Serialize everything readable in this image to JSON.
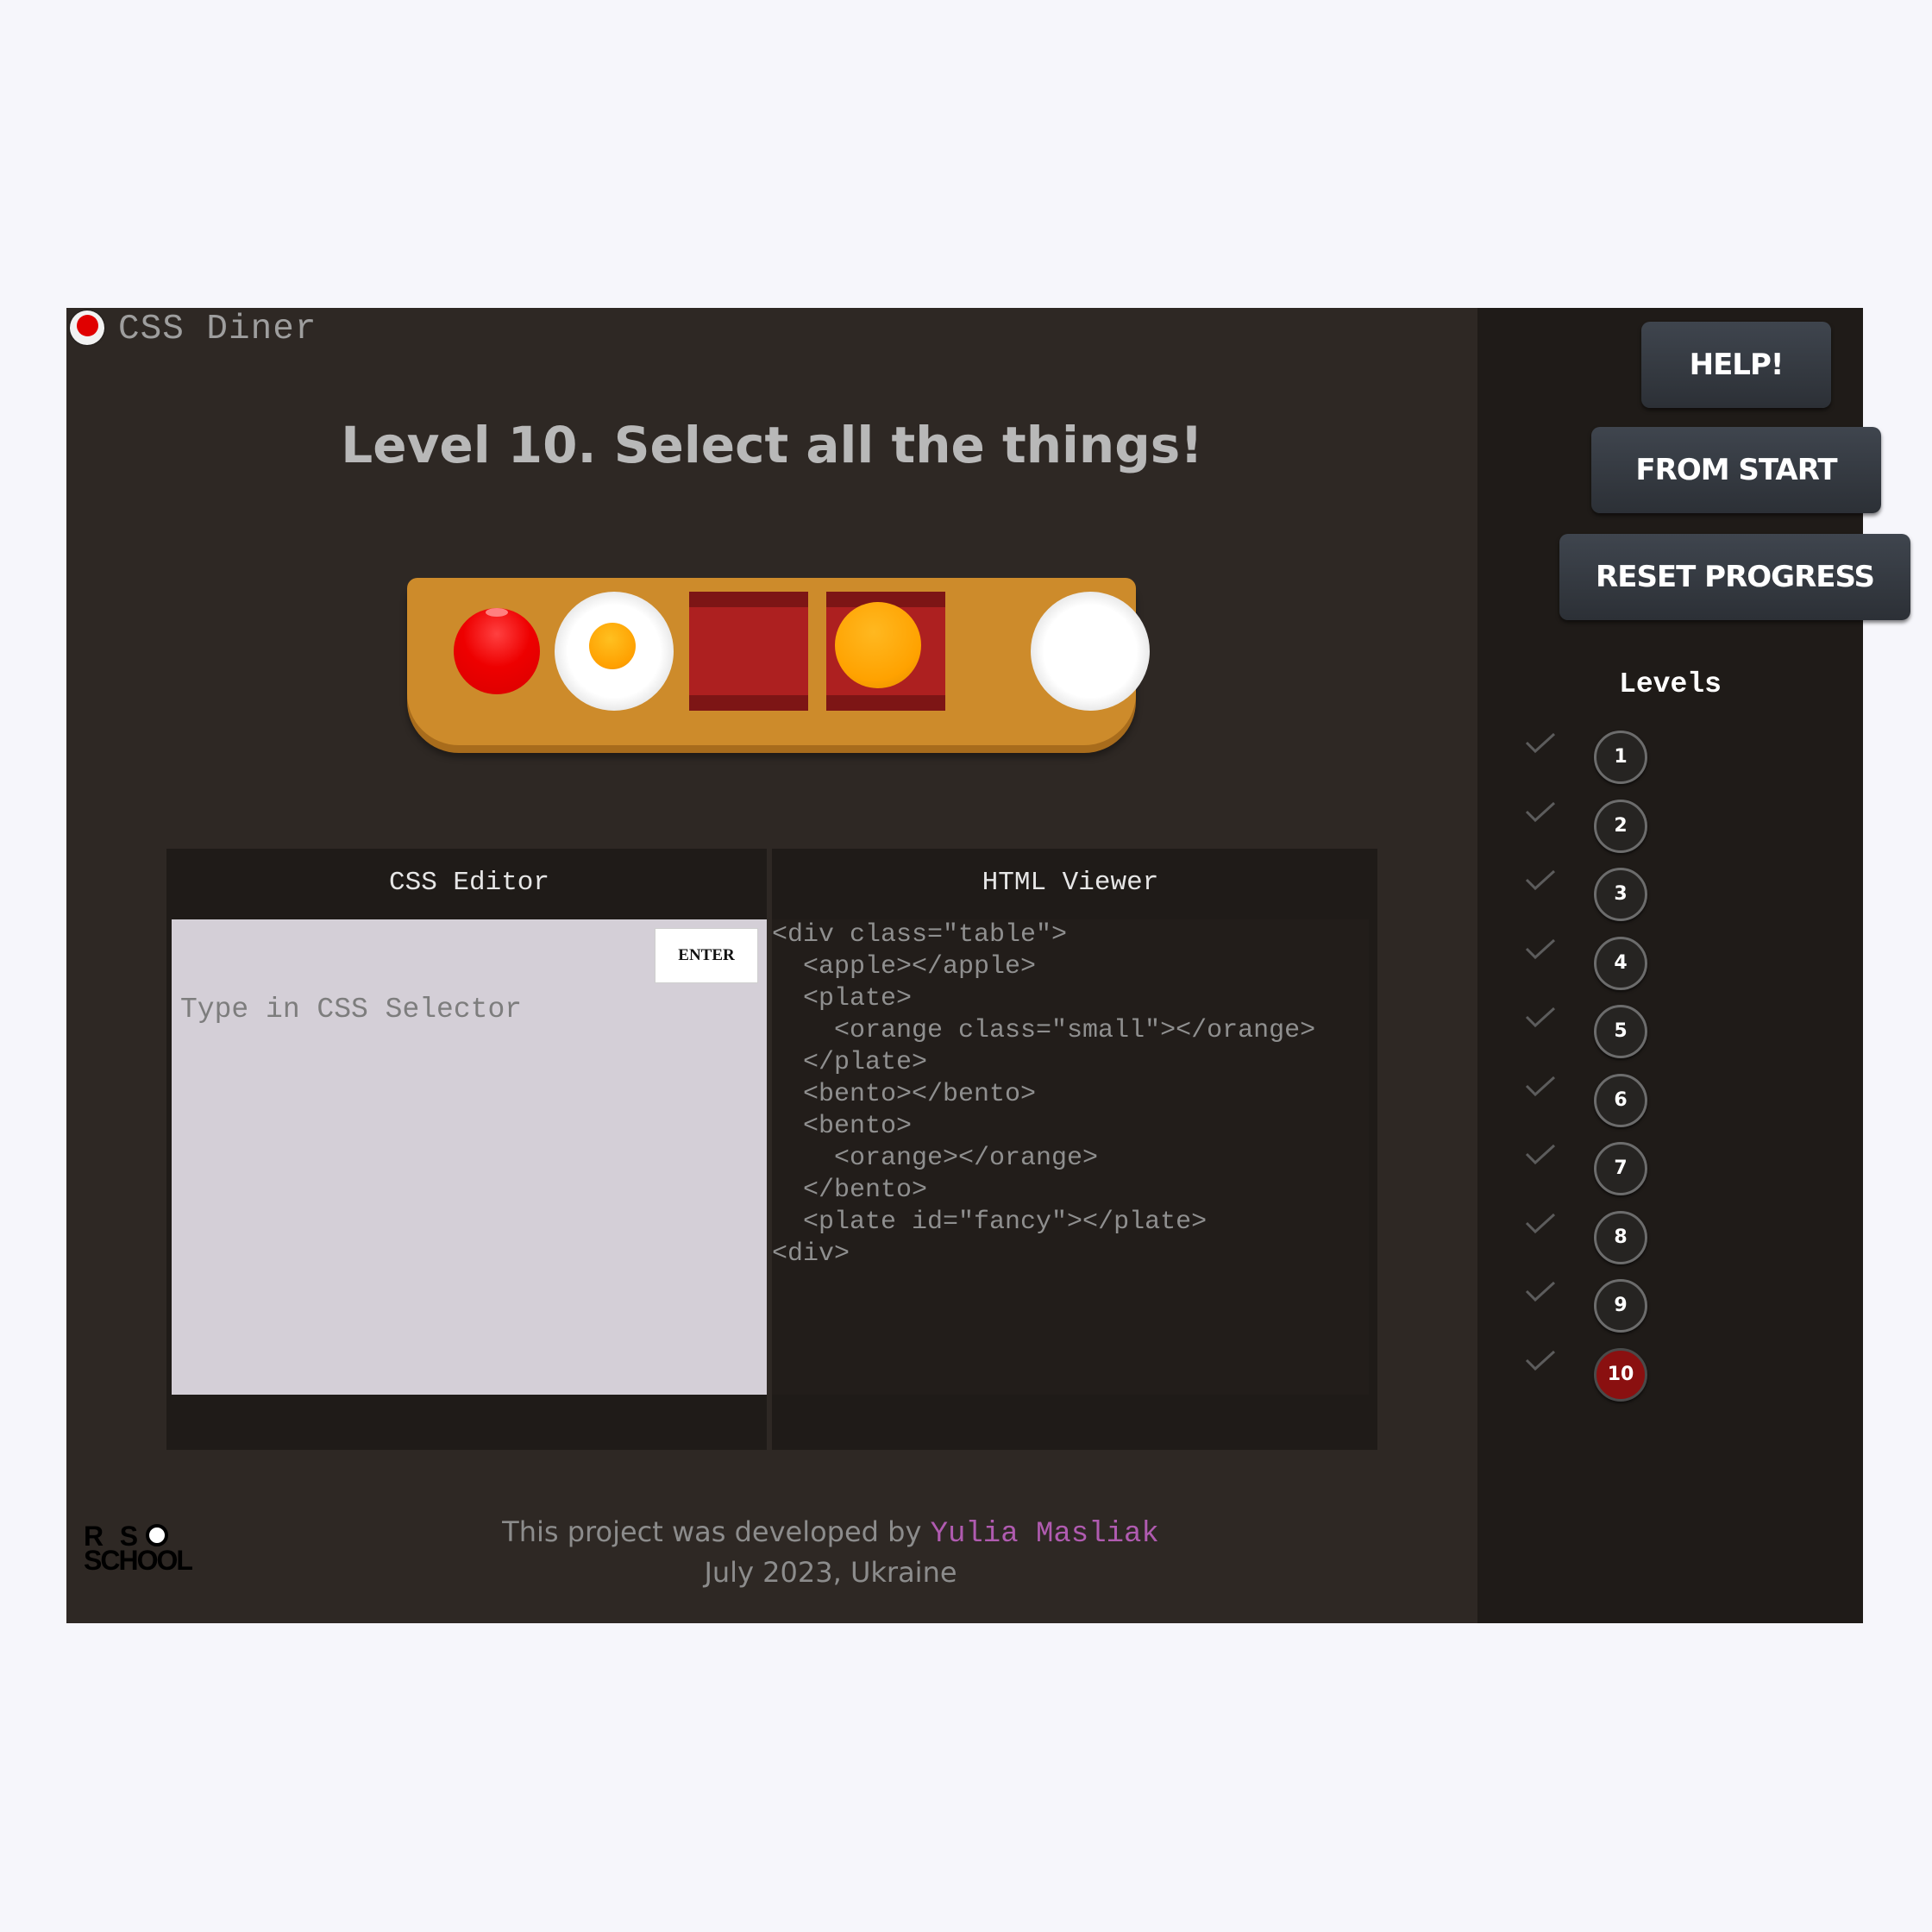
{
  "app": {
    "brand": "CSS Diner"
  },
  "level": {
    "title": "Level 10. Select all the things!"
  },
  "table": {
    "items": [
      "apple",
      "plate with small orange",
      "bento",
      "bento with orange",
      "fancy plate"
    ]
  },
  "editor": {
    "css_title": "CSS Editor",
    "html_title": "HTML Viewer",
    "placeholder": "Type in CSS Selector",
    "enter_label": "ENTER",
    "html_lines": [
      "<div class=\"table\">",
      "  <apple></apple>",
      "  <plate>",
      "    <orange class=\"small\"></orange>",
      "  </plate>",
      "  <bento></bento>",
      "  <bento>",
      "    <orange></orange>",
      "  </bento>",
      "  <plate id=\"fancy\"></plate>",
      "<div>"
    ]
  },
  "footer": {
    "text": "This project was developed by",
    "author": "Yulia Masliak",
    "date": "July 2023, Ukraine",
    "logo": "RS SCHOOL"
  },
  "sidebar": {
    "help": "HELP!",
    "from_start": "FROM START",
    "reset": "RESET PROGRESS",
    "levels_title": "Levels",
    "levels": [
      "1",
      "2",
      "3",
      "4",
      "5",
      "6",
      "7",
      "8",
      "9",
      "10"
    ],
    "current_level": "10"
  },
  "colors": {
    "accent_red": "#8a1010",
    "table": "#cd8b2b",
    "author": "#b05bb0"
  }
}
